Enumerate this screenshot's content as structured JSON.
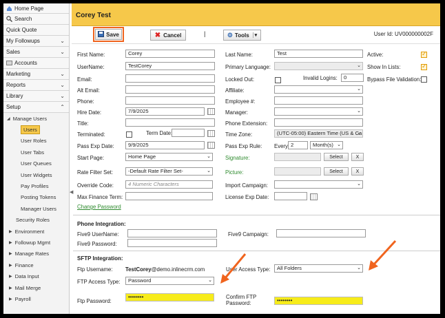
{
  "sidebar": {
    "items": [
      {
        "label": "Home Page",
        "icon": "home-icon"
      },
      {
        "label": "Search",
        "icon": "search-icon"
      },
      {
        "label": "Quick Quote"
      },
      {
        "label": "My Followups"
      },
      {
        "label": "Sales"
      },
      {
        "label": "Accounts",
        "icon": "accounts-icon"
      },
      {
        "label": "Marketing"
      },
      {
        "label": "Reports"
      },
      {
        "label": "Library"
      },
      {
        "label": "Setup"
      }
    ],
    "manage_users": "Manage Users",
    "sub_items": [
      "Users",
      "User Roles",
      "User Tabs",
      "User Queues",
      "User Widgets",
      "Pay Profiles",
      "Posting Tokens",
      "Manager Users"
    ],
    "security_roles": "Security Roles",
    "tree_items": [
      "Environment",
      "Followup Mgmt",
      "Manage Rates",
      "Finance",
      "Data Input",
      "Mail Merge",
      "Payroll"
    ]
  },
  "page": {
    "title": "Corey Test",
    "user_id": "User Id: UV000000002F"
  },
  "toolbar": {
    "save": "Save",
    "cancel": "Cancel",
    "separator": "|",
    "tools": "Tools"
  },
  "form": {
    "first_name": {
      "label": "First Name:",
      "value": "Corey"
    },
    "last_name": {
      "label": "Last Name:",
      "value": "Test"
    },
    "active": {
      "label": "Active:",
      "checked": true
    },
    "username": {
      "label": "UserName:",
      "value": "TestCorey"
    },
    "primary_language": {
      "label": "Primary Language:",
      "value": ""
    },
    "show_in_lists": {
      "label": "Show In Lists:",
      "checked": true
    },
    "email": {
      "label": "Email:",
      "value": ""
    },
    "locked_out": {
      "label": "Locked Out:",
      "checked": false
    },
    "invalid_logins": {
      "label": "Invalid Logins:",
      "value": "0"
    },
    "bypass_file_validation": {
      "label": "Bypass File Validation:",
      "checked": false
    },
    "alt_email": {
      "label": "Alt Email:",
      "value": ""
    },
    "affiliate": {
      "label": "Affiliate:",
      "value": ""
    },
    "phone": {
      "label": "Phone:",
      "value": ""
    },
    "employee_no": {
      "label": "Employee #:",
      "value": ""
    },
    "hire_date": {
      "label": "Hire Date:",
      "value": "7/9/2025"
    },
    "manager": {
      "label": "Manager:",
      "value": ""
    },
    "title": {
      "label": "Title:",
      "value": ""
    },
    "phone_extension": {
      "label": "Phone Extension:",
      "value": ""
    },
    "terminated": {
      "label": "Terminated:",
      "checked": false
    },
    "term_date": {
      "label": "Term Date:",
      "value": ""
    },
    "time_zone": {
      "label": "Time Zone:",
      "value": "(UTC-05:00) Eastern Time (US & Ca"
    },
    "pass_exp_date": {
      "label": "Pass Exp Date:",
      "value": "9/9/2025"
    },
    "pass_exp_rule": {
      "label": "Pass Exp Rule:",
      "every": "Every",
      "count": "2",
      "unit": "Month(s)"
    },
    "start_page": {
      "label": "Start Page:",
      "value": "Home Page"
    },
    "signature": {
      "label": "Signature:",
      "select": "Select",
      "clear": "X"
    },
    "rate_filter_set": {
      "label": "Rate Filter Set:",
      "value": "-Default Rate Filter Set-"
    },
    "picture": {
      "label": "Picture:",
      "select": "Select",
      "clear": "X"
    },
    "override_code": {
      "label": "Override Code:",
      "placeholder": "4 Numeric Characters"
    },
    "import_campaign": {
      "label": "Import Campaign:",
      "value": ""
    },
    "max_finance_term": {
      "label": "Max Finance Term:",
      "value": ""
    },
    "license_exp_date": {
      "label": "License Exp Date:",
      "value": ""
    },
    "change_password": "Change Password"
  },
  "phone_integration": {
    "heading": "Phone Integration:",
    "five9_username": {
      "label": "Five9 UserName:",
      "value": ""
    },
    "five9_campaign": {
      "label": "Five9 Campaign:",
      "value": ""
    },
    "five9_password": {
      "label": "Five9 Password:",
      "value": ""
    }
  },
  "sftp": {
    "heading": "SFTP Integration:",
    "ftp_username_label": "Ftp Username:",
    "ftp_username_bold": "TestCorey",
    "ftp_username_rest": "@demo.inlinecrm.com",
    "user_access_type": {
      "label": "User Access Type:",
      "value": "All Folders"
    },
    "ftp_access_type": {
      "label": "FTP Access Type:",
      "value": "Password"
    },
    "ftp_password": {
      "label": "Ftp Password:",
      "value": "••••••••"
    },
    "confirm_ftp_password": {
      "label_line1": "Confirm FTP",
      "label_line2": "Password:",
      "value": "••••••••"
    }
  },
  "colors": {
    "accent": "#f6c84a",
    "highlight": "#f0641e",
    "password_fill": "#f7ec1a",
    "link": "#2d8a2d"
  }
}
